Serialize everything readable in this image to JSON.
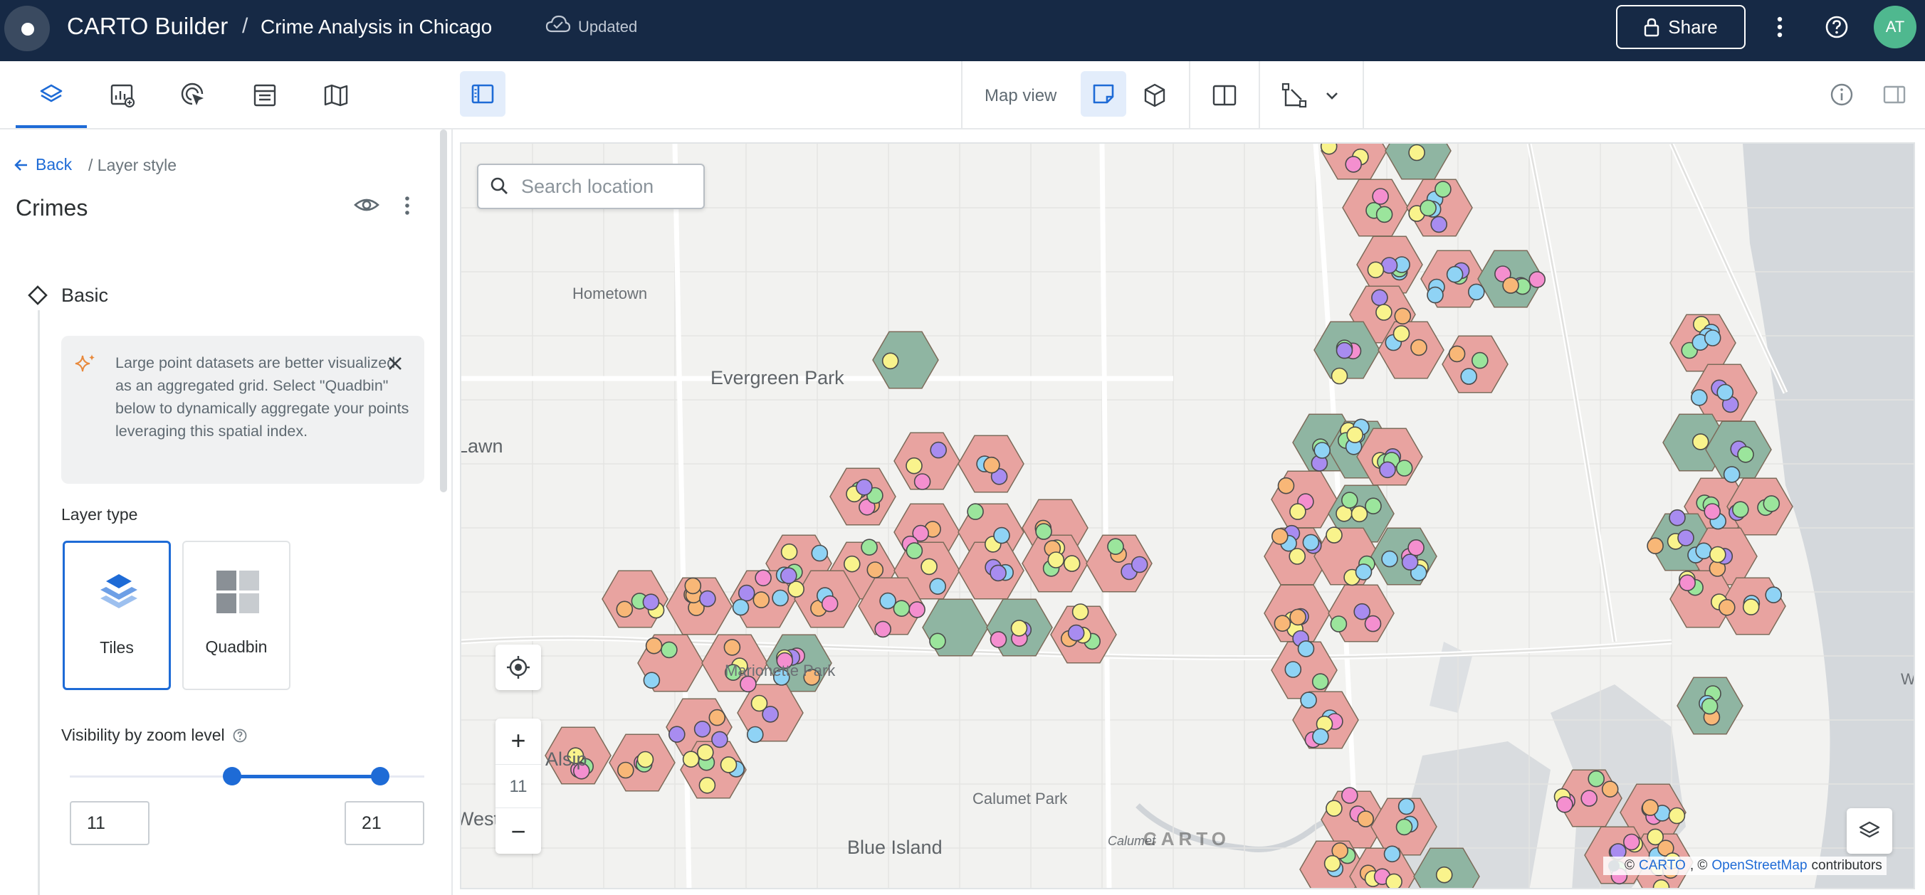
{
  "header": {
    "app_title": "CARTO Builder",
    "separator": "/",
    "map_title": "Crime Analysis in Chicago",
    "status": "Updated",
    "share_label": "Share",
    "avatar_initials": "AT"
  },
  "toolbar": {
    "map_view_label": "Map view"
  },
  "panel": {
    "back_label": "Back",
    "breadcrumb": "/ Layer style",
    "layer_name": "Crimes",
    "section_basic": "Basic",
    "info_text": "Large point datasets are better visualized as an aggregated grid. Select \"Quadbin\" below to dynamically aggregate your points leveraging this spatial index.",
    "layer_type_label": "Layer type",
    "layer_types": [
      {
        "label": "Tiles",
        "selected": true
      },
      {
        "label": "Quadbin",
        "selected": false
      }
    ],
    "zoom_visibility_label": "Visibility by zoom level",
    "zoom_min": "11",
    "zoom_max": "21",
    "zoom_range": [
      11,
      21
    ],
    "zoom_scale": [
      0,
      24
    ]
  },
  "map": {
    "search_placeholder": "Search location",
    "zoom_level": "11",
    "zoom_in": "+",
    "zoom_out": "−",
    "watermark": "CARTO",
    "attribution_prefix": "©",
    "attribution_carto": "CARTO",
    "attribution_sep": ", ©",
    "attribution_osm": "OpenStreetMap",
    "attribution_suffix": "contributors",
    "places": [
      "Hometown",
      "Evergreen Park",
      "Lawn",
      "Alsip",
      "Blue Island",
      "Calumet Park",
      "Marionette Park",
      "West",
      "Wi",
      "Calumet"
    ]
  },
  "colors": {
    "topbar": "#162945",
    "accent": "#1e6bd6",
    "hex_red": "#e8a3a0",
    "hex_green": "#8fb5a2",
    "point_colors": [
      "#f9f38c",
      "#9be59c",
      "#a88cf0",
      "#f48fcf",
      "#8fd3f5",
      "#f8b777"
    ]
  }
}
